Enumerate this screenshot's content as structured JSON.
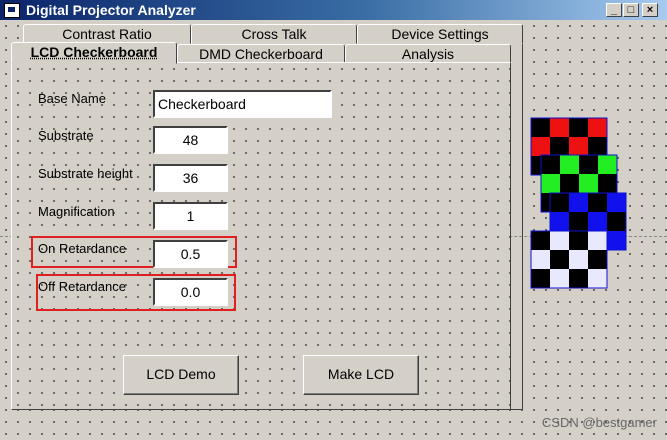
{
  "window": {
    "title": "Digital Projector Analyzer",
    "min_glyph": "_",
    "max_glyph": "□",
    "close_glyph": "×"
  },
  "tabs": {
    "back_row": [
      "Contrast Ratio",
      "Cross Talk",
      "Device Settings"
    ],
    "front_row": [
      "LCD Checkerboard",
      "DMD Checkerboard",
      "Analysis"
    ],
    "active": "LCD Checkerboard"
  },
  "form": {
    "base_name": {
      "label": "Base Name",
      "value": "Checkerboard"
    },
    "substrate": {
      "label": "Substrate",
      "value": "48"
    },
    "substrate_height": {
      "label": "Substrate height",
      "value": "36"
    },
    "magnification": {
      "label": "Magnification",
      "value": "1"
    },
    "on_retardance": {
      "label": "On Retardance",
      "value": "0.5"
    },
    "off_retardance": {
      "label": "Off Retardance",
      "value": "0.0"
    }
  },
  "buttons": {
    "lcd_demo": "LCD Demo",
    "make_lcd": "Make LCD"
  },
  "preview": {
    "layers": [
      {
        "name": "red",
        "color": "#ee1111"
      },
      {
        "name": "green",
        "color": "#22ee22"
      },
      {
        "name": "blue",
        "color": "#1111ee"
      },
      {
        "name": "white",
        "color": "#e8e8ff"
      }
    ]
  },
  "watermark": "CSDN @bestgamer"
}
